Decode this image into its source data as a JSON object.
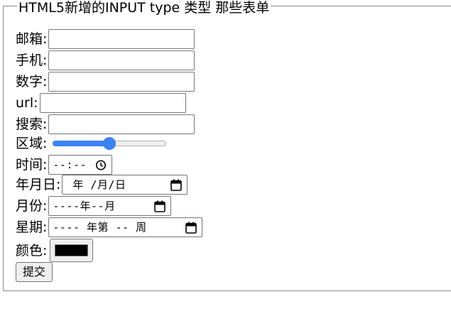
{
  "form": {
    "legend": "HTML5新增的INPUT type 类型 那些表单",
    "email": {
      "label": "邮箱:",
      "value": ""
    },
    "phone": {
      "label": "手机:",
      "value": ""
    },
    "number": {
      "label": "数字:",
      "value": ""
    },
    "url": {
      "label": "url:",
      "value": ""
    },
    "search": {
      "label": "搜索:",
      "value": ""
    },
    "range": {
      "label": "区域:",
      "value_fraction": 0.5,
      "accent": "#3b82f6"
    },
    "time": {
      "label": "时间:",
      "placeholder": "--:--",
      "icon": "clock-icon"
    },
    "date": {
      "label": "年月日:",
      "placeholder": "年 /月/日",
      "icon": "calendar-icon"
    },
    "month": {
      "label": "月份:",
      "placeholder": "----年--月",
      "icon": "calendar-icon"
    },
    "week": {
      "label": "星期:",
      "placeholder": "---- 年第 -- 周",
      "icon": "calendar-icon"
    },
    "color": {
      "label": "颜色:",
      "value": "#000000"
    },
    "submit_label": "提交"
  }
}
